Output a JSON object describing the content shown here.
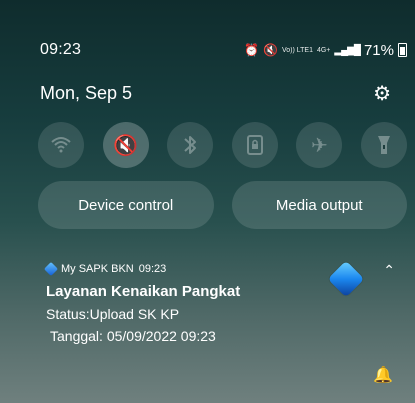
{
  "status_bar": {
    "time": "09:23",
    "alarm_icon": "alarm-icon",
    "mute_icon": "mute-icon",
    "network_label": "Vo)) LTE1",
    "network_gen": "4G+",
    "battery": "71%"
  },
  "quick_panel": {
    "date": "Mon, Sep 5",
    "settings_icon": "gear-icon",
    "toggles": [
      {
        "name": "wifi-toggle",
        "icon": "wifi-icon",
        "active": false
      },
      {
        "name": "sound-toggle",
        "icon": "mute-icon",
        "active": true
      },
      {
        "name": "bluetooth-toggle",
        "icon": "bluetooth-icon",
        "active": false
      },
      {
        "name": "portrait-lock-toggle",
        "icon": "lock-screen-icon",
        "active": false
      },
      {
        "name": "airplane-toggle",
        "icon": "airplane-icon",
        "active": false
      },
      {
        "name": "flashlight-toggle",
        "icon": "flashlight-icon",
        "active": false
      }
    ],
    "buttons": {
      "device_control": "Device control",
      "media_output": "Media output"
    }
  },
  "notification": {
    "app_name": "My SAPK BKN",
    "time": "09:23",
    "title": "Layanan Kenaikan Pangkat",
    "status_line": "Status:Upload SK KP",
    "date_line": "Tanggal: 05/09/2022 09:23",
    "expand_icon": "chevron-up-icon",
    "bell_icon": "notification-settings-icon"
  },
  "colors": {
    "active_toggle": "#f8c900"
  }
}
